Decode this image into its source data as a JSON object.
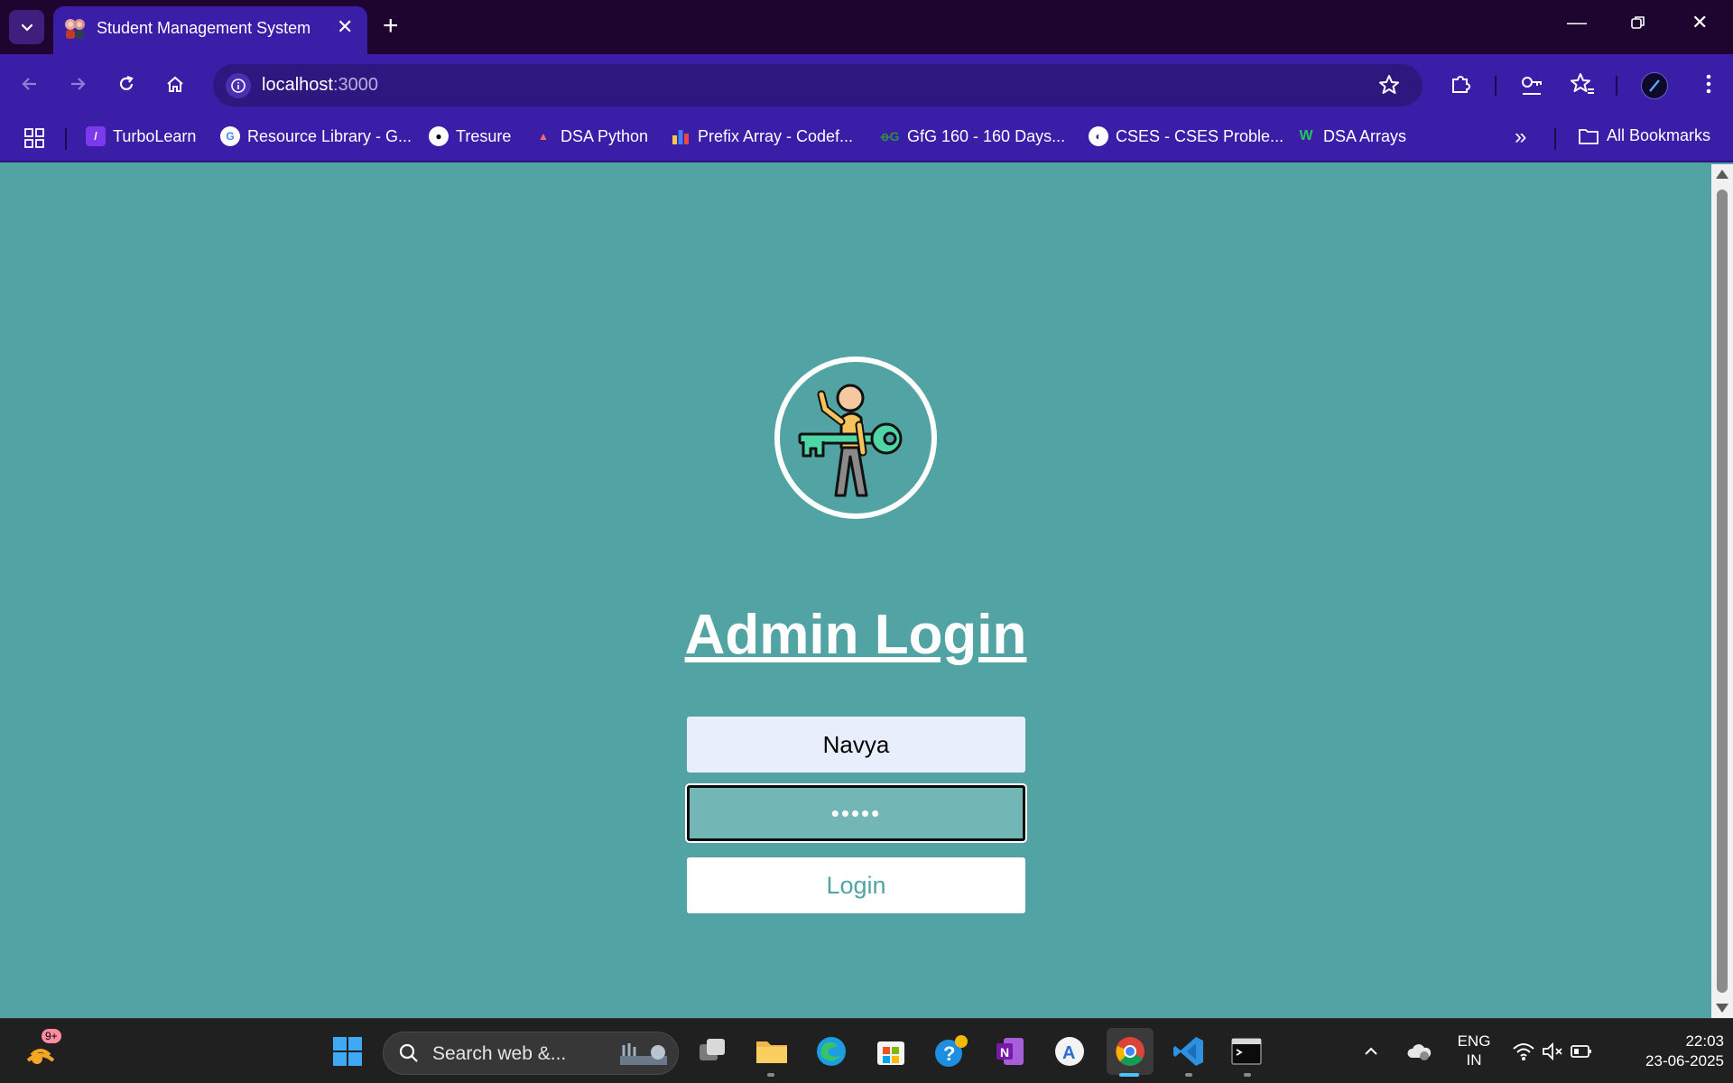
{
  "browser": {
    "tab": {
      "title": "Student Management System"
    },
    "url": {
      "host": "localhost",
      "port": ":3000"
    },
    "bookmarks": [
      {
        "label": "TurboLearn",
        "icon": "turbolearn-icon"
      },
      {
        "label": "Resource Library - G...",
        "icon": "google-icon"
      },
      {
        "label": "Tresure",
        "icon": "github-icon"
      },
      {
        "label": "DSA Python",
        "icon": "dsa-python-icon"
      },
      {
        "label": "Prefix Array - Codef...",
        "icon": "codeforces-icon"
      },
      {
        "label": "GfG 160 - 160 Days...",
        "icon": "gfg-icon"
      },
      {
        "label": "CSES - CSES Proble...",
        "icon": "globe-icon"
      },
      {
        "label": "DSA Arrays",
        "icon": "w-icon"
      }
    ],
    "all_bookmarks_label": "All Bookmarks"
  },
  "login": {
    "title": "Admin Login",
    "username_value": "Navya",
    "password_mask": "•••••",
    "button_label": "Login"
  },
  "taskbar": {
    "notification_badge": "9+",
    "search_placeholder": "Search web &...",
    "language_line1": "ENG",
    "language_line2": "IN",
    "time": "22:03",
    "date": "23-06-2025"
  },
  "colors": {
    "page_bg": "#52a3a3",
    "titlebar_bg": "#1d0530",
    "toolbar_bg": "#3a1ea8"
  }
}
